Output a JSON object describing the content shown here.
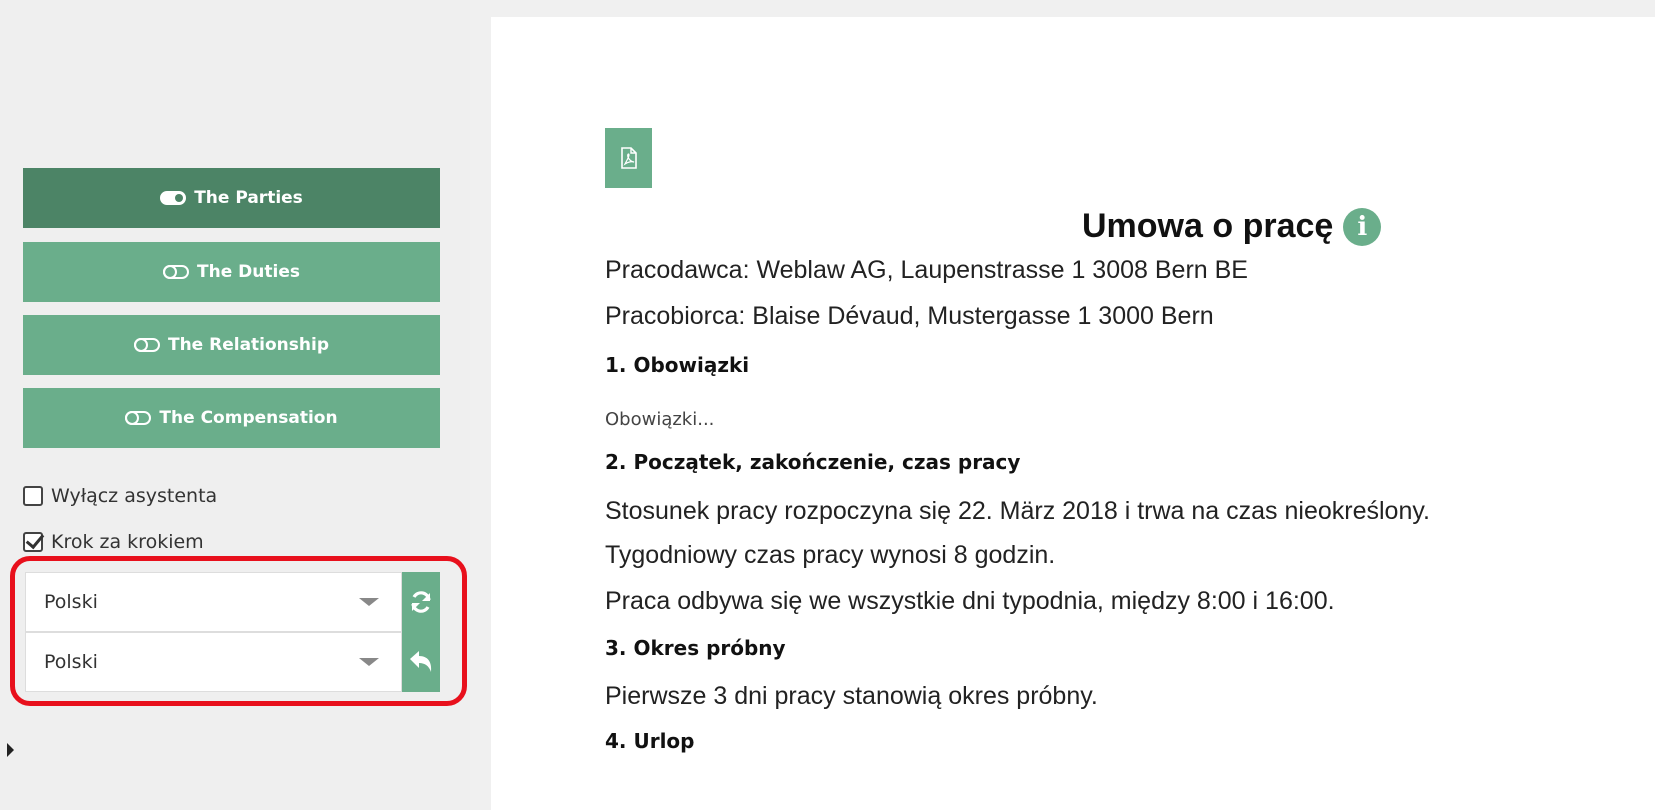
{
  "sidebar": {
    "steps": [
      {
        "label": "The Parties",
        "active": true
      },
      {
        "label": "The Duties",
        "active": false
      },
      {
        "label": "The Relationship",
        "active": false
      },
      {
        "label": "The Compensation",
        "active": false
      }
    ],
    "options": {
      "disable_assistant": {
        "label": "Wyłącz asystenta",
        "checked": false
      },
      "step_by_step": {
        "label": "Krok za krokiem",
        "checked": true
      }
    },
    "language_selects": [
      {
        "value": "Polski",
        "action_icon": "refresh-icon"
      },
      {
        "value": "Polski",
        "action_icon": "undo-icon"
      }
    ]
  },
  "document": {
    "title": "Umowa o pracę",
    "employer": "Pracodawca: Weblaw AG, Laupenstrasse 1 3008 Bern BE",
    "employee": "Pracobiorca:  Blaise Dévaud, Mustergasse 1 3000 Bern",
    "sections": [
      {
        "heading": "1.  Obowiązki",
        "lines": [
          "Obowiązki..."
        ]
      },
      {
        "heading": "2.  Początek, zakończenie, czas pracy",
        "lines": [
          "Stosunek pracy rozpoczyna się 22. März 2018 i trwa na czas nieokreślony.",
          "Tygodniowy czas pracy wynosi 8 godzin.",
          "Praca odbywa się we wszystkie dni typodnia, między 8:00 i 16:00."
        ]
      },
      {
        "heading": "3.  Okres próbny",
        "lines": [
          "Pierwsze 3 dni pracy stanowią okres próbny."
        ]
      },
      {
        "heading": "4.  Urlop",
        "lines": []
      }
    ]
  },
  "colors": {
    "accent": "#6aae8b",
    "accent_dark": "#4c8466",
    "highlight": "#e8101c"
  }
}
